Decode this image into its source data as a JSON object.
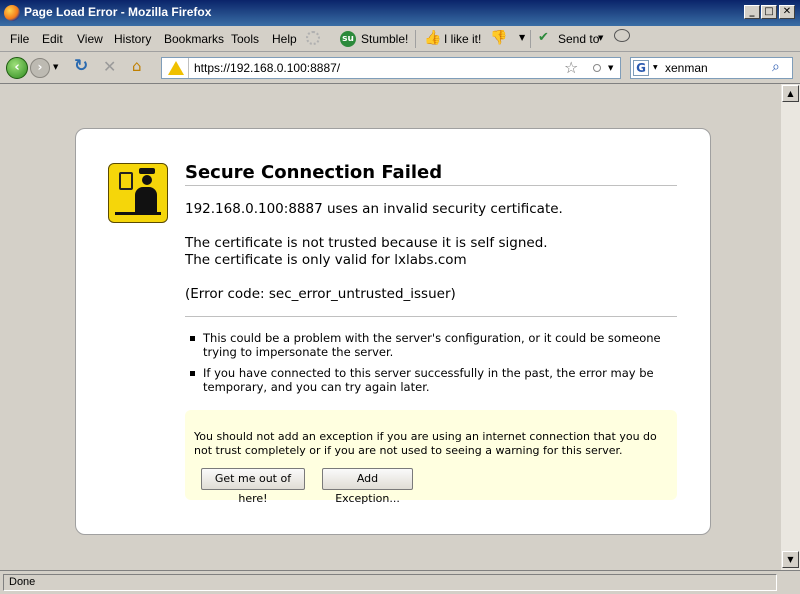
{
  "window": {
    "title": "Page Load Error - Mozilla Firefox"
  },
  "menu": {
    "items": [
      "File",
      "Edit",
      "View",
      "History",
      "Bookmarks",
      "Tools",
      "Help"
    ],
    "stumble_label": "Stumble!",
    "like_label": "I like it!",
    "send_label": "Send to"
  },
  "nav": {
    "url": "https://192.168.0.100:8887/",
    "search_value": "xenman"
  },
  "error": {
    "title": "Secure Connection Failed",
    "line1": "192.168.0.100:8887 uses an invalid security certificate.",
    "line2": "The certificate is not trusted because it is self signed.",
    "line3": "The certificate is only valid for lxlabs.com",
    "line4": "(Error code: sec_error_untrusted_issuer)",
    "bullets": [
      "This could be a problem with the server's configuration, or it could be someone trying to impersonate the server.",
      "If you have connected to this server successfully in the past, the error may be temporary, and you can try again later."
    ],
    "warning": "You should not add an exception if you are using an internet connection that you do not trust completely or if you are not used to seeing a warning for this server.",
    "btn_out": "Get me out of here!",
    "btn_exception": "Add Exception..."
  },
  "status": {
    "text": "Done"
  }
}
